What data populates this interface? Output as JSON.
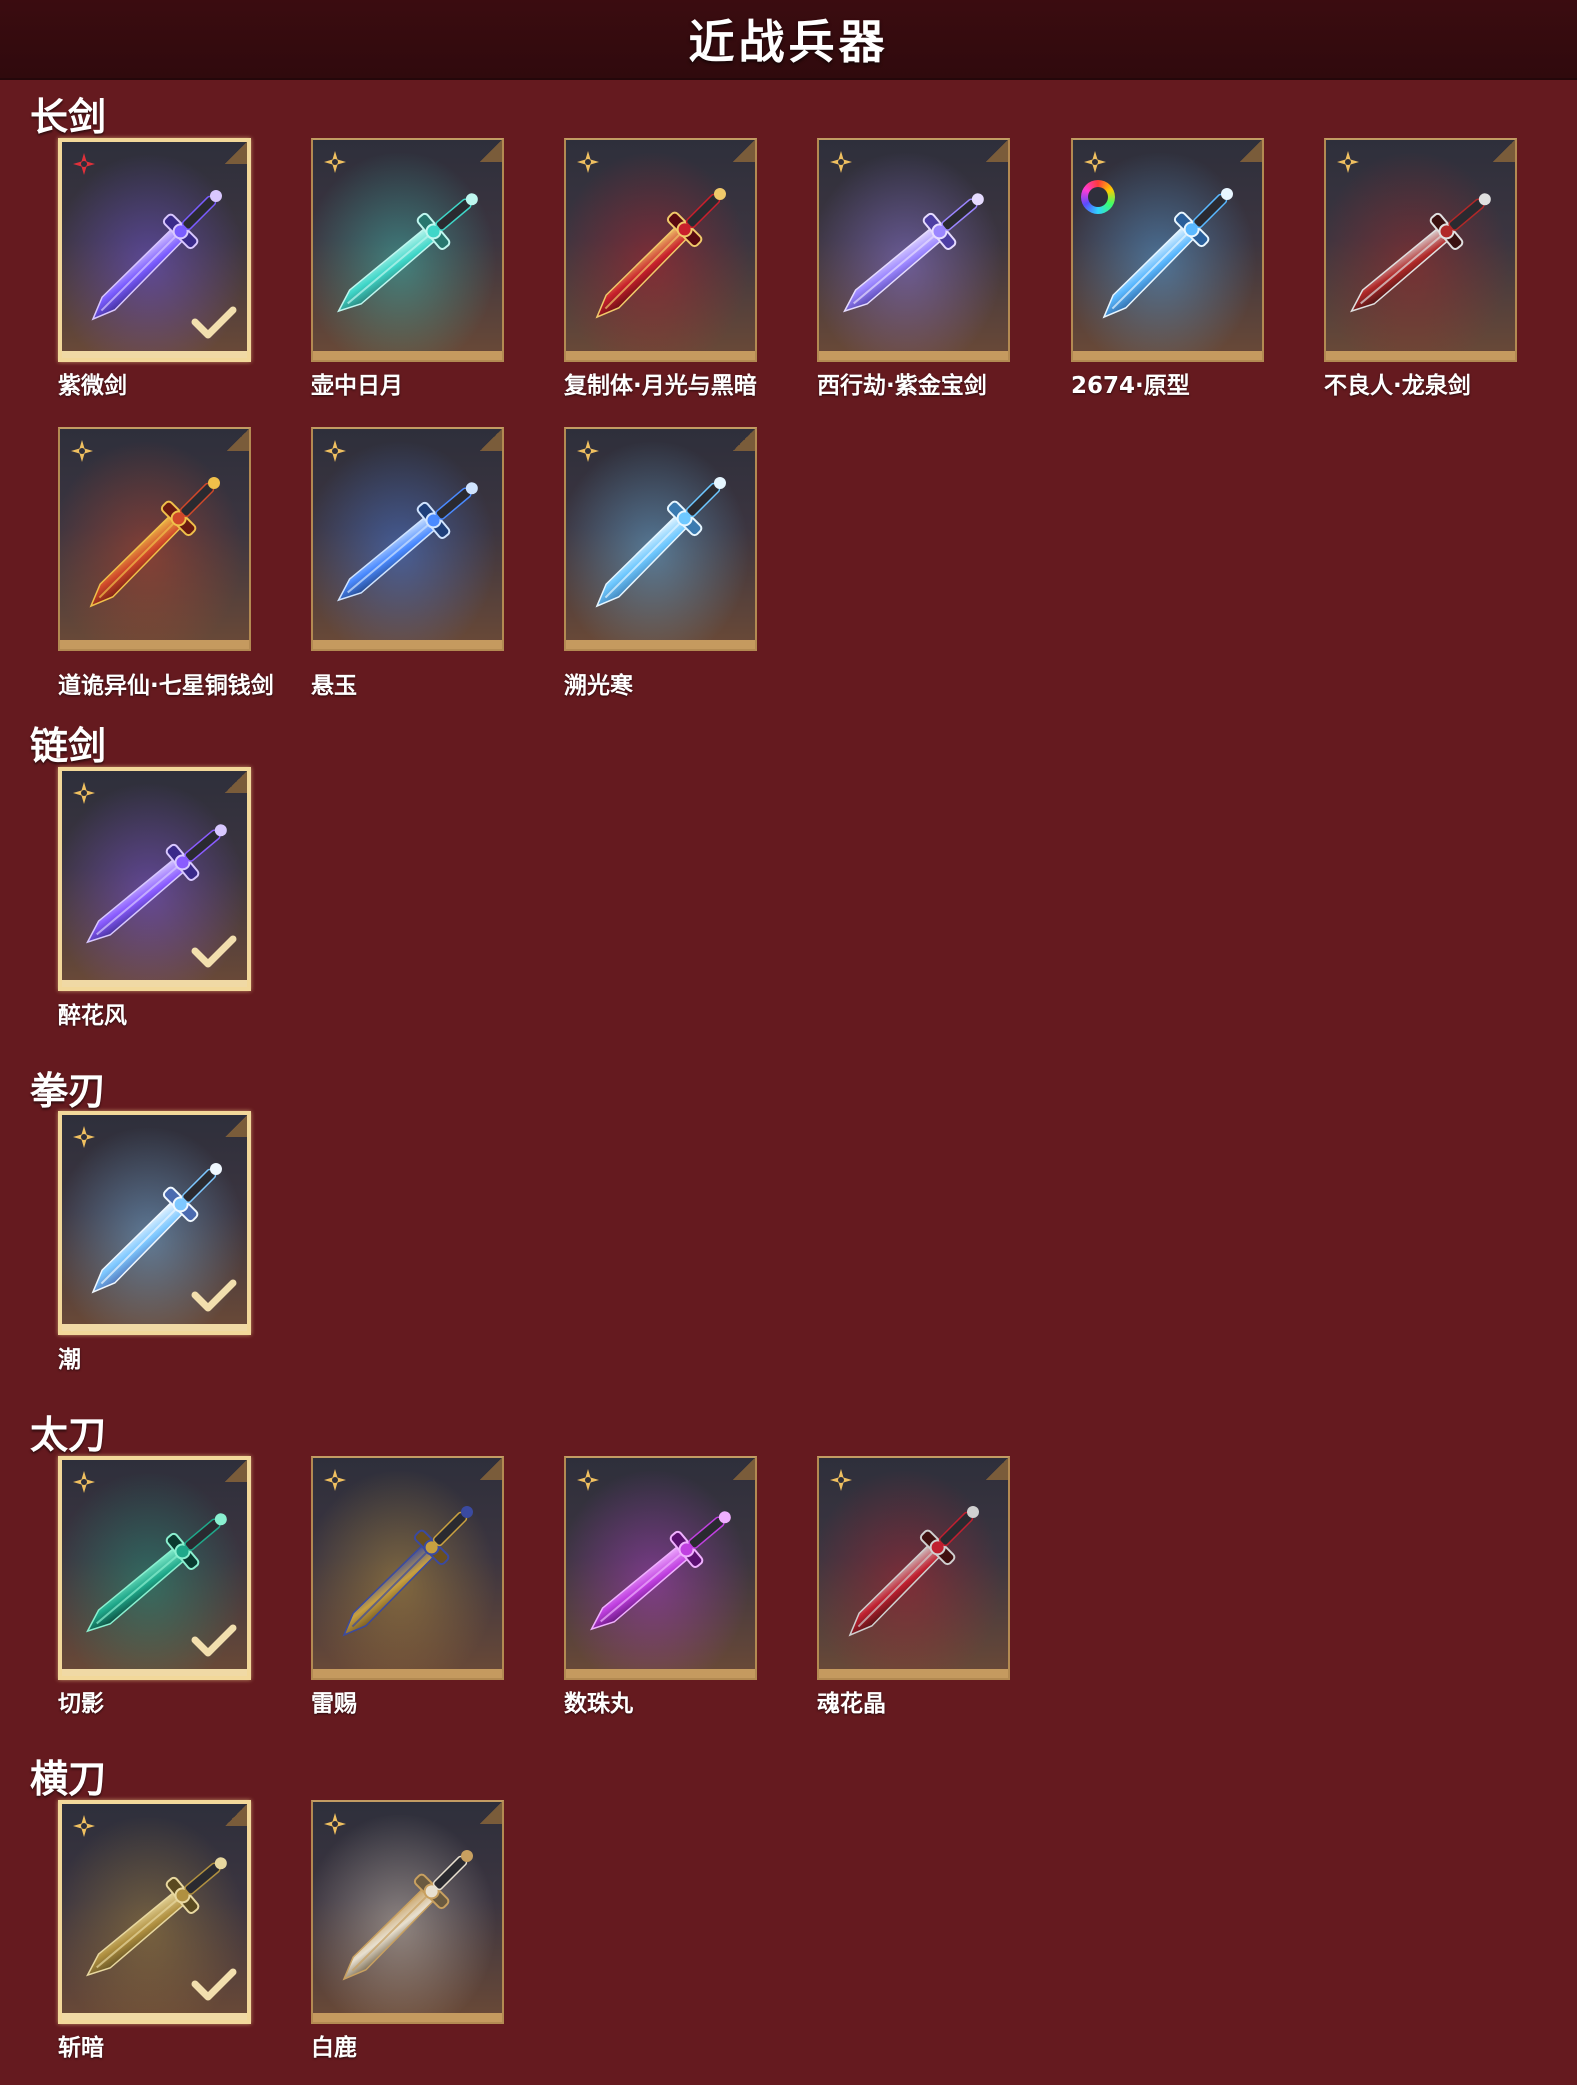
{
  "title": "近战兵器",
  "sections": [
    {
      "name": "长剑",
      "items": [
        {
          "name": "紫微剑",
          "star": "red-star-icon",
          "selected": true
        },
        {
          "name": "壶中日月",
          "star": "gold-star-icon",
          "selected": false
        },
        {
          "name": "复制体·月光与黑暗",
          "star": "gold-star-icon",
          "selected": false
        },
        {
          "name": "西行劫·紫金宝剑",
          "star": "gold-star-icon",
          "selected": false
        },
        {
          "name": "2674·原型",
          "star": "gold-star-icon",
          "selected": false,
          "badge": "color-ring-icon"
        },
        {
          "name": "不良人·龙泉剑",
          "star": "gold-star-icon",
          "selected": false
        },
        {
          "name": "道诡异仙·七星铜钱剑",
          "star": "gold-star-icon",
          "selected": false
        },
        {
          "name": "悬玉",
          "star": "gold-star-icon",
          "selected": false
        },
        {
          "name": "溯光寒",
          "star": "gold-star-icon",
          "selected": false
        }
      ]
    },
    {
      "name": "链剑",
      "items": [
        {
          "name": "醉花风",
          "star": "gold-star-icon",
          "selected": true
        }
      ]
    },
    {
      "name": "拳刃",
      "items": [
        {
          "name": "潮",
          "star": "gold-star-icon",
          "selected": true
        }
      ]
    },
    {
      "name": "太刀",
      "items": [
        {
          "name": "切影",
          "star": "gold-star-icon",
          "selected": true
        },
        {
          "name": "雷赐",
          "star": "gold-star-icon",
          "selected": false
        },
        {
          "name": "数珠丸",
          "star": "gold-star-icon",
          "selected": false
        },
        {
          "name": "魂花晶",
          "star": "gold-star-icon",
          "selected": false
        }
      ]
    },
    {
      "name": "横刀",
      "items": [
        {
          "name": "斩暗",
          "star": "gold-star-icon",
          "selected": true
        },
        {
          "name": "白鹿",
          "star": "gold-star-icon",
          "selected": false
        }
      ]
    }
  ],
  "colors": {
    "background": "#651a1f",
    "header": "#3b0c10",
    "frame_border": "#b38a52",
    "selected_border": "#f2d89a",
    "gold_star": "#f0c060",
    "red_star": "#e0303a"
  }
}
